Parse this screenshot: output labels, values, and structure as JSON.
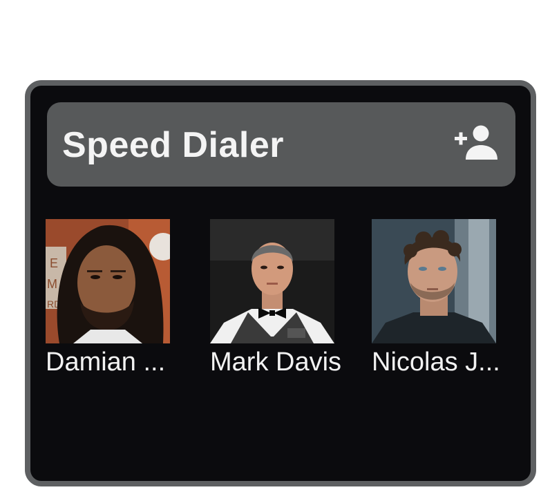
{
  "widget": {
    "title": "Speed Dialer",
    "add_icon": "person-add-icon"
  },
  "contacts": [
    {
      "name": "Damian ...",
      "photo": "contact-photo-damian"
    },
    {
      "name": "Mark Davis",
      "photo": "contact-photo-mark"
    },
    {
      "name": "Nicolas J...",
      "photo": "contact-photo-nicolas"
    }
  ],
  "colors": {
    "widget_bg": "#0b0b0e",
    "widget_border": "#5e6062",
    "header_bg": "#57595a",
    "text": "#f4f4f4"
  }
}
